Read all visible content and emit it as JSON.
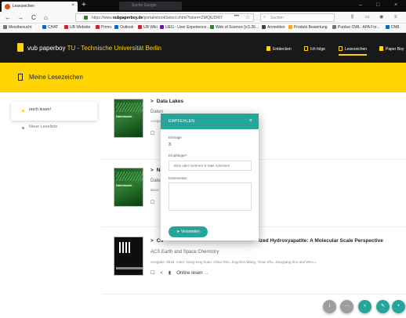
{
  "browser": {
    "active_tab": {
      "label": "Lesezeichen",
      "close": "×"
    },
    "new_tab": "+",
    "background_tab": {
      "label": "Suche Google"
    },
    "window_controls": [
      "–",
      "□",
      "×"
    ],
    "nav": {
      "back": "←",
      "forward": "→",
      "reload": "C",
      "home": "⌂"
    },
    "url": {
      "prefix": "https://www.",
      "domain": "vubpaperboy.de",
      "path": "/portal/ebookSelect.xhtml?token=ZWQiUDRI7",
      "more": "•••",
      "bookmark": "☆"
    },
    "search": {
      "icon": "⌕",
      "placeholder": "Suchen"
    },
    "toolbar_icons": [
      "⫼",
      "▭",
      "◉",
      "≡"
    ],
    "bookmarks": [
      {
        "label": "Meistbesucht",
        "color": "#757575"
      },
      {
        "label": "CHAT",
        "color": "#1565c0"
      },
      {
        "label": "UB Website",
        "color": "#c62828"
      },
      {
        "label": "Primo",
        "color": "#c62828"
      },
      {
        "label": "Outlook",
        "color": "#1565c0"
      },
      {
        "label": "UB Wiki",
        "color": "#c62828"
      },
      {
        "label": "UEG - User Experience ...",
        "color": "#6a1b9a"
      },
      {
        "label": "Web of Science [v.5.26...",
        "color": "#2e7d32"
      },
      {
        "label": "Anmelden",
        "color": "#37474f"
      },
      {
        "label": "Produkt Bewertung",
        "color": "#f9a825"
      },
      {
        "label": "Purdue OWL: APA For...",
        "color": "#757575"
      },
      {
        "label": "DNB",
        "color": "#1565c0"
      }
    ]
  },
  "app": {
    "logo_text": "vub paperboy",
    "university": "TU - Technische Universität Berlin",
    "nav": [
      {
        "label": "Entdecken",
        "active": false
      },
      {
        "label": "Ich folge",
        "active": false
      },
      {
        "label": "Lesezeichen",
        "active": true
      },
      {
        "label": "Paper Boy",
        "active": false
      }
    ],
    "page_title": "Meine Lesezeichen"
  },
  "sidebar": {
    "items": [
      {
        "label": "noch lesen!",
        "active": true
      },
      {
        "label": "Neue Leseliste",
        "active": false
      }
    ]
  },
  "items": [
    {
      "cover_title": "Datenbank",
      "title": "Data Lakes",
      "subtitle": "Daten",
      "meta": "Ausgabe",
      "actions": [
        "☐",
        "⊕"
      ]
    },
    {
      "cover_title": "Datenbank",
      "title": "Ne",
      "subtitle": "Daten",
      "meta": "Band: 1",
      "actions": [
        "☐",
        "⊕"
      ]
    },
    {
      "cover_title": "",
      "title_start": "Ch",
      "title": "ized Hydroxyapatite: A Molecular Scale Perspective",
      "subtitle": "ACS Earth and Space Chemistry",
      "meta": "Ausgabe: 2018, Autor: Dong-Eng Xuan, Chao Ren, Jingchen Wang, Yinan Zhu, Zangyang Zhu and Wei Li",
      "actions": [
        "☐",
        "<",
        "▮"
      ],
      "online": "Online lesen",
      "online_arrow": "→"
    }
  ],
  "modal": {
    "title": "EMPFEHLEN",
    "close": "×",
    "entries_label": "Einträge",
    "entries_value": "3",
    "recipients_label": "Empfänger*",
    "recipients_placeholder": "Eine oder mehrere E-Mail Adressen",
    "comment_label": "Kommentar",
    "send_label": "Versenden",
    "send_icon": "➤"
  },
  "fabs": [
    {
      "icon": "i",
      "color": "#9e9e9e"
    },
    {
      "icon": "⋯",
      "color": "#9e9e9e"
    },
    {
      "icon": "<",
      "color": "#26a69a"
    },
    {
      "icon": "✎",
      "color": "#26a69a"
    },
    {
      "icon": "+",
      "color": "#26a69a"
    }
  ]
}
